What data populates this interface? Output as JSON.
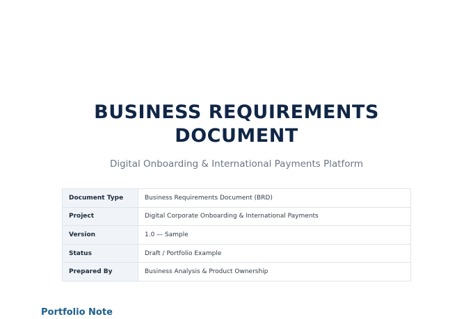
{
  "title_lines": [
    "BUSINESS REQUIREMENTS",
    "DOCUMENT"
  ],
  "subtitle": "Digital Onboarding & International Payments Platform",
  "meta_table": [
    {
      "key": "Document Type",
      "value": "Business Requirements Document (BRD)"
    },
    {
      "key": "Project",
      "value": "Digital Corporate Onboarding & International Payments"
    },
    {
      "key": "Version",
      "value": "1.0 — Sample"
    },
    {
      "key": "Status",
      "value": "Draft / Portfolio Example"
    },
    {
      "key": "Prepared By",
      "value": "Business Analysis & Product Ownership"
    }
  ],
  "section_heading": "Portfolio Note",
  "colors": {
    "title": "#102646",
    "subtitle": "#6b7684",
    "heading_accent": "#1e5f8c",
    "key_cell_bg": "#f0f4f8",
    "border": "#dfe4ea"
  }
}
